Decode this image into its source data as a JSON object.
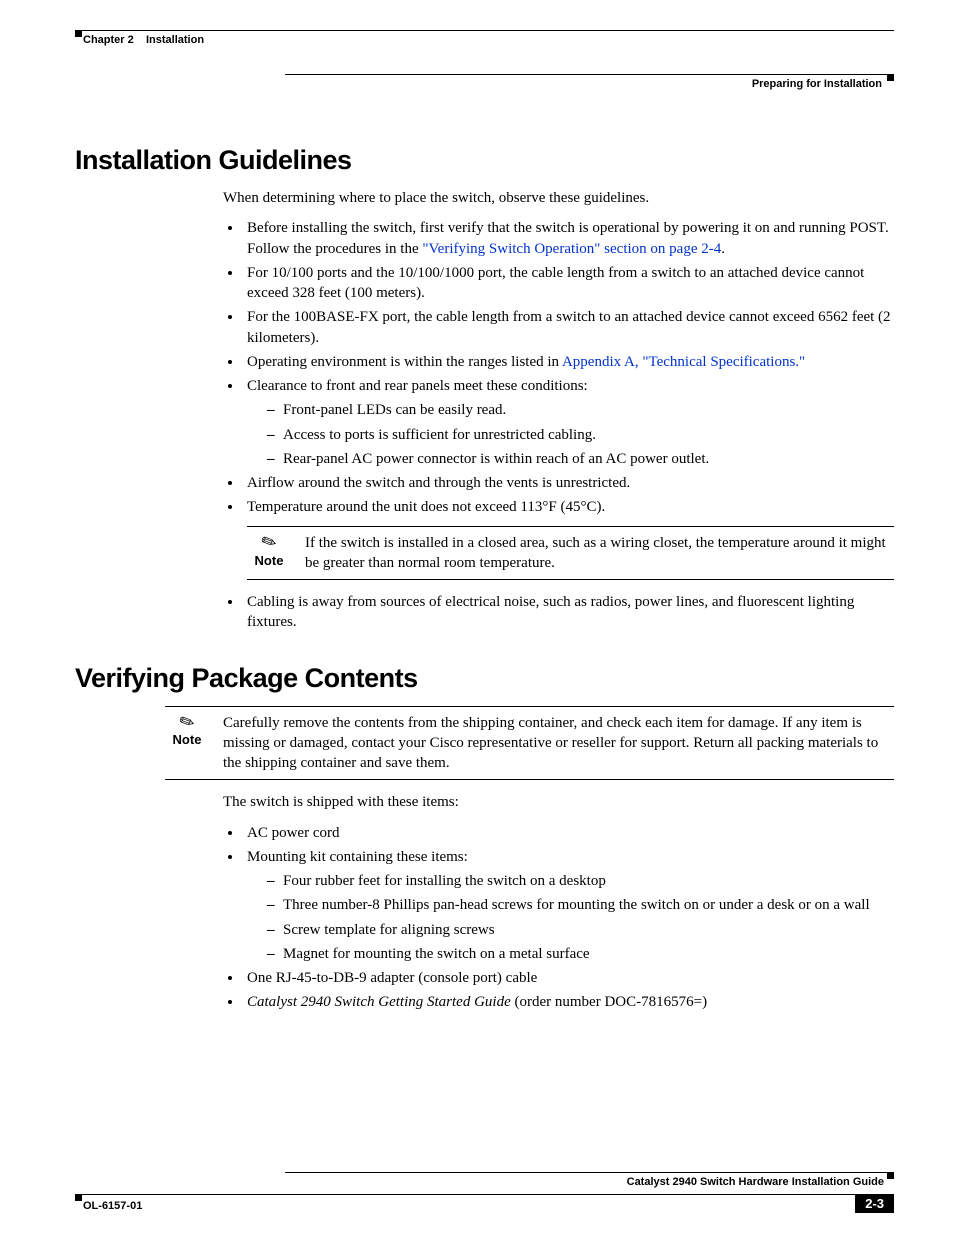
{
  "header": {
    "chapter_label": "Chapter 2",
    "chapter_title": "Installation",
    "section_right": "Preparing for Installation"
  },
  "sections": {
    "guidelines": {
      "heading": "Installation Guidelines",
      "intro": "When determining where to place the switch, observe these guidelines.",
      "bullets": {
        "b1a": "Before installing the switch, first verify that the switch is operational by powering it on and running POST. Follow the procedures in the ",
        "b1a_link": "\"Verifying Switch Operation\" section on page 2-4",
        "b1a_tail": ".",
        "b2": "For 10/100 ports and the 10/100/1000 port, the cable length from a switch to an attached device cannot exceed 328 feet (100 meters).",
        "b3": "For the 100BASE-FX port, the cable length from a switch to an attached device cannot exceed 6562 feet (2 kilometers).",
        "b4a": "Operating environment is within the ranges listed in ",
        "b4_link": "Appendix A, \"Technical Specifications.\"",
        "b5": "Clearance to front and rear panels meet these conditions:",
        "b5_sub": {
          "s1": "Front-panel LEDs can be easily read.",
          "s2": "Access to ports is sufficient for unrestricted cabling.",
          "s3": "Rear-panel AC power connector is within reach of an AC power outlet."
        },
        "b6": "Airflow around the switch and through the vents is unrestricted.",
        "b7": "Temperature around the unit does not exceed 113°F (45°C).",
        "note_label": "Note",
        "note_text": "If the switch is installed in a closed area, such as a wiring closet, the temperature around it might be greater than normal room temperature.",
        "b8": "Cabling is away from sources of electrical noise, such as radios, power lines, and fluorescent lighting fixtures."
      }
    },
    "verify": {
      "heading": "Verifying Package Contents",
      "note_label": "Note",
      "note_text": "Carefully remove the contents from the shipping container, and check each item for damage. If any item is missing or damaged, contact your Cisco representative or reseller for support. Return all packing materials to the shipping container and save them.",
      "intro": "The switch is shipped with these items:",
      "bullets": {
        "b1": "AC power cord",
        "b2": "Mounting kit containing these items:",
        "b2_sub": {
          "s1": "Four rubber feet for installing the switch on a desktop",
          "s2": "Three number-8 Phillips pan-head screws for mounting the switch on or under a desk or on a wall",
          "s3": "Screw template for aligning screws",
          "s4": "Magnet for mounting the switch on a metal surface"
        },
        "b3": "One RJ-45-to-DB-9 adapter (console port) cable",
        "b4_em": "Catalyst 2940 Switch Getting Started Guide",
        "b4_tail": " (order number DOC-7816576=)"
      }
    }
  },
  "footer": {
    "guide": "Catalyst 2940 Switch Hardware Installation Guide",
    "doc_id": "OL-6157-01",
    "page": "2-3"
  }
}
